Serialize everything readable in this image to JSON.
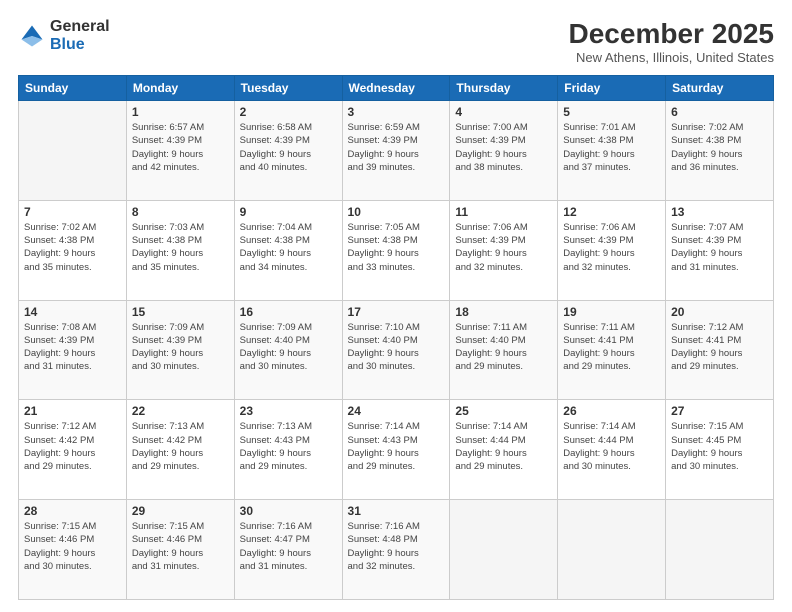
{
  "header": {
    "logo": {
      "general": "General",
      "blue": "Blue"
    },
    "title": "December 2025",
    "subtitle": "New Athens, Illinois, United States"
  },
  "weekdays": [
    "Sunday",
    "Monday",
    "Tuesday",
    "Wednesday",
    "Thursday",
    "Friday",
    "Saturday"
  ],
  "weeks": [
    [
      {
        "day": "",
        "info": ""
      },
      {
        "day": "1",
        "info": "Sunrise: 6:57 AM\nSunset: 4:39 PM\nDaylight: 9 hours\nand 42 minutes."
      },
      {
        "day": "2",
        "info": "Sunrise: 6:58 AM\nSunset: 4:39 PM\nDaylight: 9 hours\nand 40 minutes."
      },
      {
        "day": "3",
        "info": "Sunrise: 6:59 AM\nSunset: 4:39 PM\nDaylight: 9 hours\nand 39 minutes."
      },
      {
        "day": "4",
        "info": "Sunrise: 7:00 AM\nSunset: 4:39 PM\nDaylight: 9 hours\nand 38 minutes."
      },
      {
        "day": "5",
        "info": "Sunrise: 7:01 AM\nSunset: 4:38 PM\nDaylight: 9 hours\nand 37 minutes."
      },
      {
        "day": "6",
        "info": "Sunrise: 7:02 AM\nSunset: 4:38 PM\nDaylight: 9 hours\nand 36 minutes."
      }
    ],
    [
      {
        "day": "7",
        "info": "Sunrise: 7:02 AM\nSunset: 4:38 PM\nDaylight: 9 hours\nand 35 minutes."
      },
      {
        "day": "8",
        "info": "Sunrise: 7:03 AM\nSunset: 4:38 PM\nDaylight: 9 hours\nand 35 minutes."
      },
      {
        "day": "9",
        "info": "Sunrise: 7:04 AM\nSunset: 4:38 PM\nDaylight: 9 hours\nand 34 minutes."
      },
      {
        "day": "10",
        "info": "Sunrise: 7:05 AM\nSunset: 4:38 PM\nDaylight: 9 hours\nand 33 minutes."
      },
      {
        "day": "11",
        "info": "Sunrise: 7:06 AM\nSunset: 4:39 PM\nDaylight: 9 hours\nand 32 minutes."
      },
      {
        "day": "12",
        "info": "Sunrise: 7:06 AM\nSunset: 4:39 PM\nDaylight: 9 hours\nand 32 minutes."
      },
      {
        "day": "13",
        "info": "Sunrise: 7:07 AM\nSunset: 4:39 PM\nDaylight: 9 hours\nand 31 minutes."
      }
    ],
    [
      {
        "day": "14",
        "info": "Sunrise: 7:08 AM\nSunset: 4:39 PM\nDaylight: 9 hours\nand 31 minutes."
      },
      {
        "day": "15",
        "info": "Sunrise: 7:09 AM\nSunset: 4:39 PM\nDaylight: 9 hours\nand 30 minutes."
      },
      {
        "day": "16",
        "info": "Sunrise: 7:09 AM\nSunset: 4:40 PM\nDaylight: 9 hours\nand 30 minutes."
      },
      {
        "day": "17",
        "info": "Sunrise: 7:10 AM\nSunset: 4:40 PM\nDaylight: 9 hours\nand 30 minutes."
      },
      {
        "day": "18",
        "info": "Sunrise: 7:11 AM\nSunset: 4:40 PM\nDaylight: 9 hours\nand 29 minutes."
      },
      {
        "day": "19",
        "info": "Sunrise: 7:11 AM\nSunset: 4:41 PM\nDaylight: 9 hours\nand 29 minutes."
      },
      {
        "day": "20",
        "info": "Sunrise: 7:12 AM\nSunset: 4:41 PM\nDaylight: 9 hours\nand 29 minutes."
      }
    ],
    [
      {
        "day": "21",
        "info": "Sunrise: 7:12 AM\nSunset: 4:42 PM\nDaylight: 9 hours\nand 29 minutes."
      },
      {
        "day": "22",
        "info": "Sunrise: 7:13 AM\nSunset: 4:42 PM\nDaylight: 9 hours\nand 29 minutes."
      },
      {
        "day": "23",
        "info": "Sunrise: 7:13 AM\nSunset: 4:43 PM\nDaylight: 9 hours\nand 29 minutes."
      },
      {
        "day": "24",
        "info": "Sunrise: 7:14 AM\nSunset: 4:43 PM\nDaylight: 9 hours\nand 29 minutes."
      },
      {
        "day": "25",
        "info": "Sunrise: 7:14 AM\nSunset: 4:44 PM\nDaylight: 9 hours\nand 29 minutes."
      },
      {
        "day": "26",
        "info": "Sunrise: 7:14 AM\nSunset: 4:44 PM\nDaylight: 9 hours\nand 30 minutes."
      },
      {
        "day": "27",
        "info": "Sunrise: 7:15 AM\nSunset: 4:45 PM\nDaylight: 9 hours\nand 30 minutes."
      }
    ],
    [
      {
        "day": "28",
        "info": "Sunrise: 7:15 AM\nSunset: 4:46 PM\nDaylight: 9 hours\nand 30 minutes."
      },
      {
        "day": "29",
        "info": "Sunrise: 7:15 AM\nSunset: 4:46 PM\nDaylight: 9 hours\nand 31 minutes."
      },
      {
        "day": "30",
        "info": "Sunrise: 7:16 AM\nSunset: 4:47 PM\nDaylight: 9 hours\nand 31 minutes."
      },
      {
        "day": "31",
        "info": "Sunrise: 7:16 AM\nSunset: 4:48 PM\nDaylight: 9 hours\nand 32 minutes."
      },
      {
        "day": "",
        "info": ""
      },
      {
        "day": "",
        "info": ""
      },
      {
        "day": "",
        "info": ""
      }
    ]
  ]
}
